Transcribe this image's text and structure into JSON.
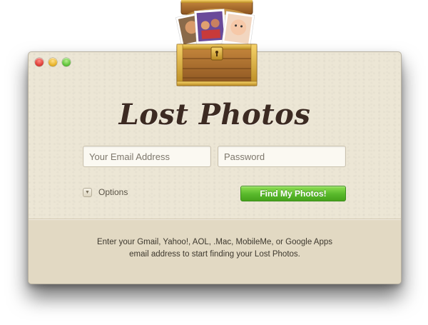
{
  "app": {
    "title": "Lost Photos"
  },
  "form": {
    "email_placeholder": "Your Email Address",
    "password_placeholder": "Password",
    "options_label": "Options",
    "submit_label": "Find My Photos!"
  },
  "footer": {
    "line1": "Enter your Gmail, Yahoo!, AOL, .Mac, MobileMe, or Google Apps",
    "line2": "email address to start finding your Lost Photos."
  },
  "colors": {
    "window_bg": "#ece6d5",
    "footer_bg": "#e2d9c3",
    "accent_green": "#58b82b",
    "title_brown": "#3c2a22"
  },
  "icons": [
    "treasure-chest-icon",
    "close-icon",
    "minimize-icon",
    "zoom-icon",
    "disclosure-triangle-icon"
  ]
}
